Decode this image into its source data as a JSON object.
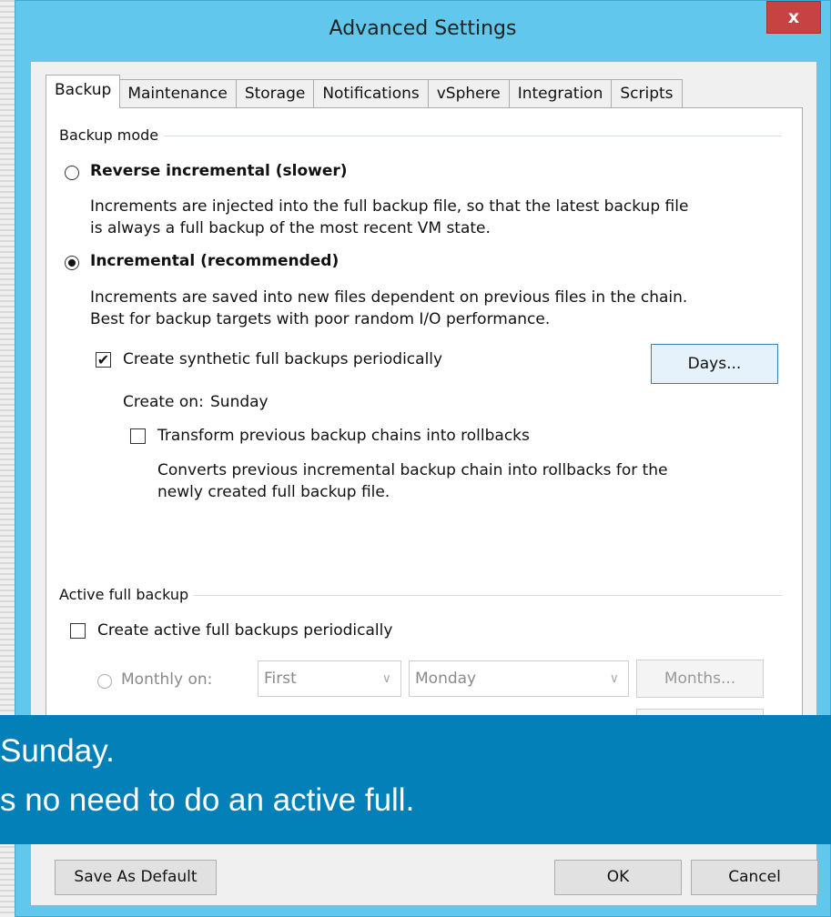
{
  "window": {
    "title": "Advanced Settings",
    "close_label": "x"
  },
  "tabs": [
    {
      "label": "Backup",
      "active": true
    },
    {
      "label": "Maintenance"
    },
    {
      "label": "Storage"
    },
    {
      "label": "Notifications"
    },
    {
      "label": "vSphere"
    },
    {
      "label": "Integration"
    },
    {
      "label": "Scripts"
    }
  ],
  "backup_mode": {
    "group_label": "Backup mode",
    "reverse": {
      "label": "Reverse incremental (slower)",
      "checked": false,
      "desc_line1": "Increments are injected into the full backup file, so that the latest backup file",
      "desc_line2": "is always a full backup of the most recent VM state."
    },
    "incremental": {
      "label": "Incremental (recommended)",
      "checked": true,
      "desc_line1": "Increments are saved into new files dependent on previous files in the chain.",
      "desc_line2": "Best for backup targets with poor random I/O performance."
    },
    "synthetic": {
      "label": "Create synthetic full backups periodically",
      "checked": true,
      "check_glyph": "✔",
      "days_button": "Days...",
      "create_on_label": "Create on:",
      "create_on_value": "Sunday"
    },
    "transform": {
      "label": "Transform previous backup chains into rollbacks",
      "checked": false,
      "desc_line1": "Converts previous incremental backup chain into rollbacks for the",
      "desc_line2": "newly created full backup file."
    }
  },
  "active_full": {
    "group_label": "Active full backup",
    "create_label": "Create active full backups periodically",
    "checked": false,
    "monthly_label": "Monthly on:",
    "week_select": "First",
    "day_select": "Monday",
    "months_button": "Months..."
  },
  "overlay": {
    "line1": "Sunday.",
    "line2": "s no need to do an active full."
  },
  "footer": {
    "save_default": "Save As Default",
    "ok": "OK",
    "cancel": "Cancel"
  },
  "colors": {
    "title_bar": "#62c7ec",
    "close_button": "#c74343",
    "overlay": "#0380b7"
  }
}
